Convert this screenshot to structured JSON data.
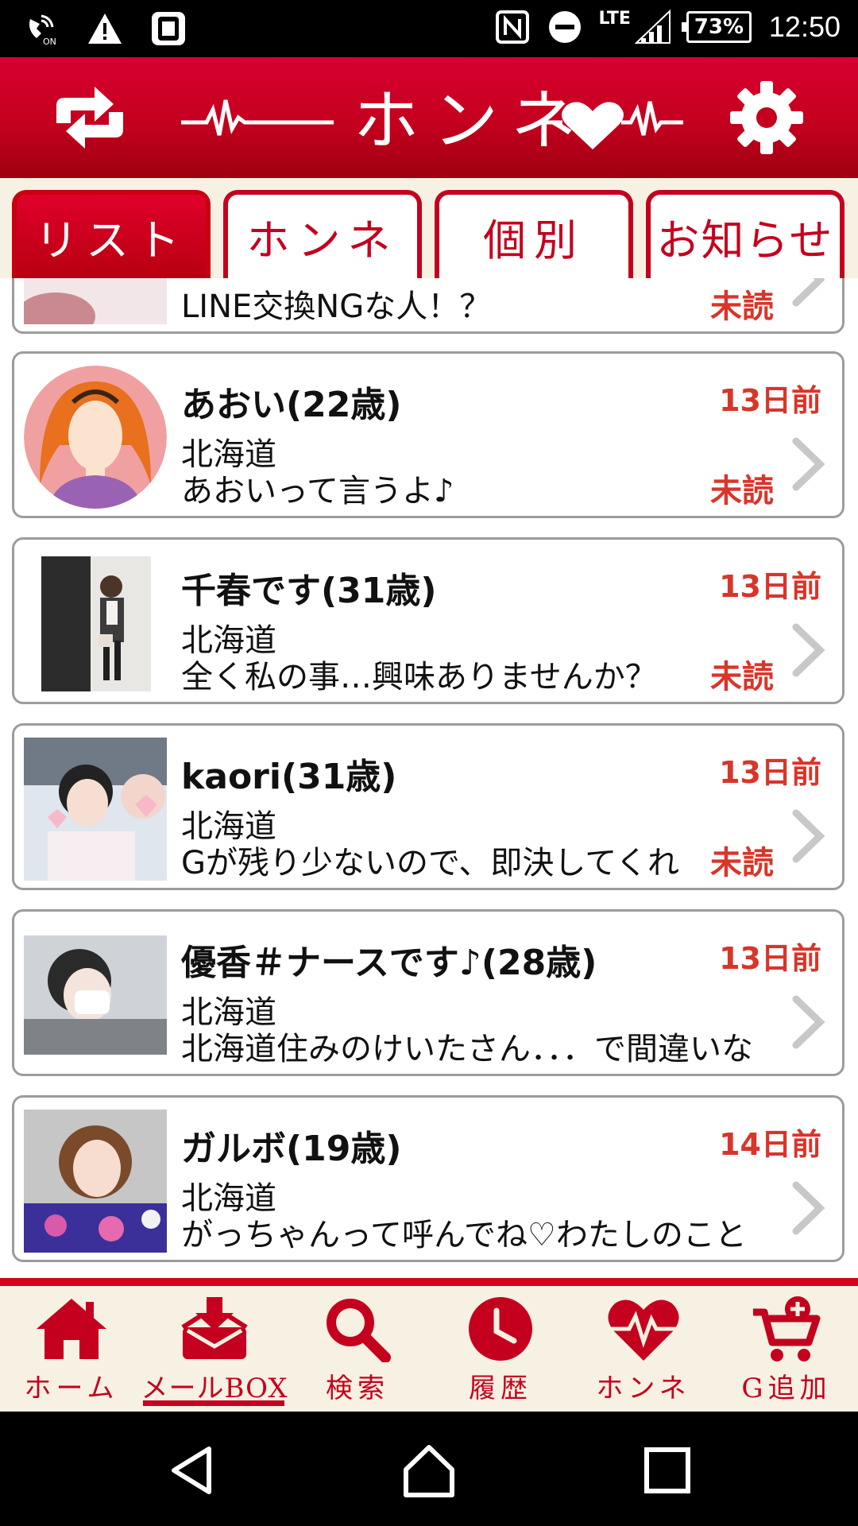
{
  "status_bar": {
    "left_icons": [
      "wifi-calling-icon",
      "warning-icon",
      "app-notification-icon"
    ],
    "right_icons": [
      "nfc-icon",
      "do-not-disturb-icon",
      "signal-icon"
    ],
    "lte_label": "LTE",
    "battery": "73%",
    "time": "12:50"
  },
  "header": {
    "title": "ホンネ",
    "left_icon": "switch-arrows-icon",
    "right_icon": "gear-icon",
    "color": "#c4001e"
  },
  "tabs": [
    {
      "label": "リスト",
      "active": true
    },
    {
      "label": "ホンネ",
      "active": false
    },
    {
      "label": "個別",
      "active": false
    },
    {
      "label": "お知らせ",
      "active": false
    }
  ],
  "partial_item": {
    "message": "LINE交換NGな人！？",
    "status": "未読"
  },
  "messages": [
    {
      "name": "あおい(22歳)",
      "date": "13日前",
      "area": "北海道",
      "message": "あおいって言うよ♪",
      "status": "未読"
    },
    {
      "name": "千春です(31歳)",
      "date": "13日前",
      "area": "北海道",
      "message": "全く私の事…興味ありませんか？",
      "status": "未読"
    },
    {
      "name": "kaori(31歳)",
      "date": "13日前",
      "area": "北海道",
      "message": "Gが残り少ないので、即決してくれ",
      "status": "未読"
    },
    {
      "name": "優香＃ナースです♪(28歳)",
      "date": "13日前",
      "area": "北海道",
      "message": "北海道住みのけいたさん．．．で間違いな",
      "status": ""
    },
    {
      "name": "ガルボ(19歳)",
      "date": "14日前",
      "area": "北海道",
      "message": "がっちゃんって呼んでね♡わたしのこと",
      "status": ""
    }
  ],
  "bottom_nav": [
    {
      "label": "ホーム",
      "icon": "home-icon"
    },
    {
      "label": "メールBOX",
      "icon": "mailbox-icon",
      "active": true
    },
    {
      "label": "検索",
      "icon": "search-icon"
    },
    {
      "label": "履歴",
      "icon": "history-clock-icon"
    },
    {
      "label": "ホンネ",
      "icon": "heart-pulse-icon"
    },
    {
      "label": "G追加",
      "icon": "cart-add-icon"
    }
  ],
  "colors": {
    "accent": "#c4001e",
    "date_red": "#d9352a",
    "tab_bg": "#f6f1e2"
  }
}
